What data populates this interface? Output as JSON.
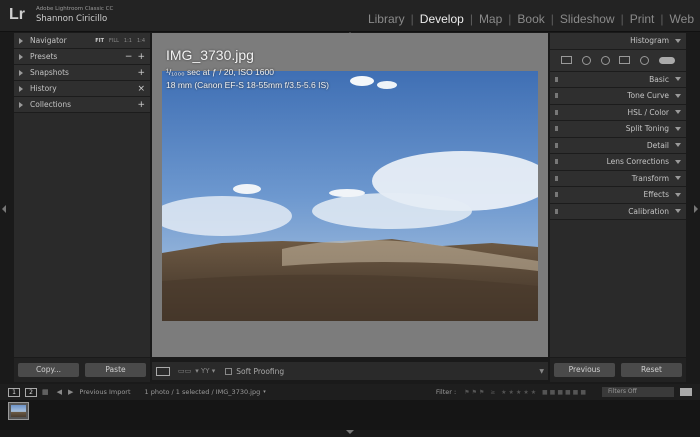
{
  "topbar": {
    "logo": "Lr",
    "app_name": "Adobe Lightroom Classic CC",
    "user_name": "Shannon Ciricillo",
    "modules": [
      {
        "label": "Library",
        "active": false
      },
      {
        "label": "Develop",
        "active": true
      },
      {
        "label": "Map",
        "active": false
      },
      {
        "label": "Book",
        "active": false
      },
      {
        "label": "Slideshow",
        "active": false
      },
      {
        "label": "Print",
        "active": false
      },
      {
        "label": "Web",
        "active": false
      }
    ]
  },
  "left_panel": {
    "navigator": {
      "label": "Navigator",
      "zoom": [
        "FIT",
        "FILL",
        "1:1",
        "1:4"
      ]
    },
    "presets": {
      "label": "Presets",
      "minus": "−",
      "plus": "+"
    },
    "snapshots": {
      "label": "Snapshots",
      "plus": "+"
    },
    "history": {
      "label": "History",
      "clear": "×"
    },
    "collections": {
      "label": "Collections",
      "plus": "+"
    },
    "copy_button": "Copy...",
    "paste_button": "Paste"
  },
  "center": {
    "filename": "IMG_3730.jpg",
    "exposure": "¹/₁₀₀₀ sec at ƒ / 20, ISO 1600",
    "lens": "18 mm (Canon EF-S 18-55mm f/3.5-5.6 IS)"
  },
  "toolbar": {
    "soft_proofing": "Soft Proofing"
  },
  "right_panel": {
    "histogram": "Histogram",
    "sections": [
      "Basic",
      "Tone Curve",
      "HSL / Color",
      "Split Toning",
      "Detail",
      "Lens Corrections",
      "Transform",
      "Effects",
      "Calibration"
    ],
    "previous_button": "Previous",
    "reset_button": "Reset"
  },
  "filmbar": {
    "monitor1": "1",
    "monitor2": "2",
    "source": "Previous Import",
    "selection": "1 photo / 1 selected / IMG_3730.jpg",
    "filter_label": "Filter :",
    "filters_value": "Filters Off"
  }
}
